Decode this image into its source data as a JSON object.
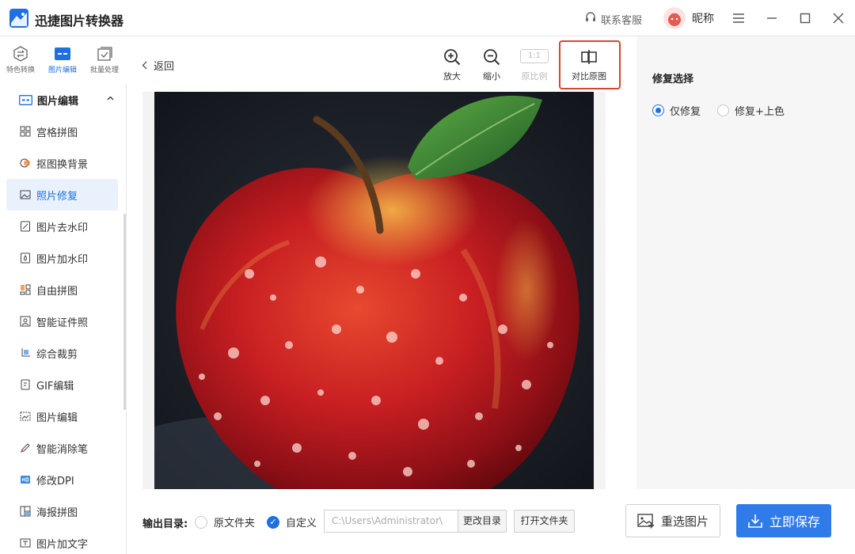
{
  "app": {
    "title": "迅捷图片转换器"
  },
  "header": {
    "support_label": "联系客服",
    "nickname": "昵称"
  },
  "modes": [
    {
      "label": "特色转换",
      "icon": "convert-icon",
      "active": false
    },
    {
      "label": "图片编辑",
      "icon": "image-edit-icon",
      "active": true
    },
    {
      "label": "批量处理",
      "icon": "batch-icon",
      "active": false
    }
  ],
  "sidebar": {
    "group_title": "图片编辑",
    "items": [
      {
        "label": "宫格拼图",
        "icon": "grid-icon"
      },
      {
        "label": "抠图换背景",
        "icon": "cutout-icon"
      },
      {
        "label": "照片修复",
        "icon": "photo-repair-icon",
        "active": true
      },
      {
        "label": "图片去水印",
        "icon": "remove-watermark-icon"
      },
      {
        "label": "图片加水印",
        "icon": "add-watermark-icon"
      },
      {
        "label": "自由拼图",
        "icon": "free-collage-icon"
      },
      {
        "label": "智能证件照",
        "icon": "id-photo-icon"
      },
      {
        "label": "综合裁剪",
        "icon": "crop-icon"
      },
      {
        "label": "GIF编辑",
        "icon": "gif-icon"
      },
      {
        "label": "图片编辑",
        "icon": "edit-image-icon"
      },
      {
        "label": "智能消除笔",
        "icon": "eraser-pen-icon"
      },
      {
        "label": "修改DPI",
        "icon": "dpi-icon"
      },
      {
        "label": "海报拼图",
        "icon": "poster-icon"
      },
      {
        "label": "图片加文字",
        "icon": "add-text-icon"
      }
    ]
  },
  "toolbar": {
    "back_label": "返回",
    "zoom_in": "放大",
    "zoom_out": "缩小",
    "ratio_box": "1:1",
    "original_ratio": "原比例",
    "compare": "对比原图"
  },
  "panel": {
    "title": "修复选择",
    "options": [
      {
        "label": "仅修复",
        "checked": true
      },
      {
        "label": "修复+上色",
        "checked": false
      }
    ]
  },
  "output": {
    "label": "输出目录:",
    "option_original": "原文件夹",
    "option_custom": "自定义",
    "path_value": "C:\\Users\\Administrator\\",
    "change_dir": "更改目录",
    "open_folder": "打开文件夹"
  },
  "actions": {
    "reselect": "重选图片",
    "save": "立即保存"
  },
  "colors": {
    "accent": "#2f7bea",
    "highlight_border": "#d9452f",
    "active_bg": "#e9f1fd"
  }
}
